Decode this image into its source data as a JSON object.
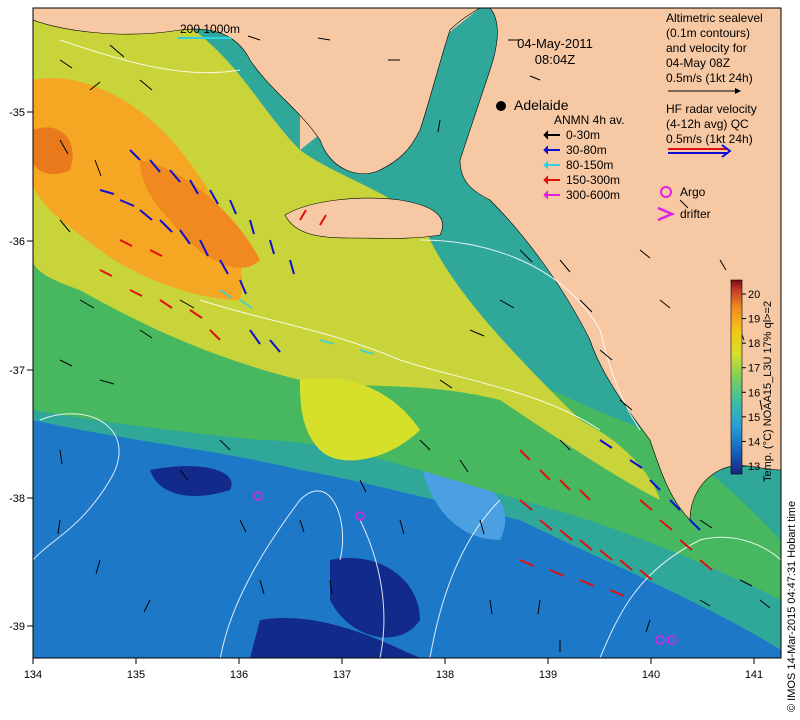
{
  "map": {
    "title_date": "04-May-2011",
    "title_time": "08:04Z",
    "scale_bar_label": "200  1000m",
    "city": "Adelaide",
    "lon_ticks": [
      "134",
      "135",
      "136",
      "137",
      "138",
      "139",
      "140",
      "141"
    ],
    "lat_ticks": [
      "-35",
      "-36",
      "-37",
      "-38",
      "-39"
    ]
  },
  "legend": {
    "altimetry_lines": [
      "Altimetric sealevel",
      "(0.1m contours)",
      "and velocity for",
      "04-May 08Z",
      "0.5m/s (1kt 24h)"
    ],
    "hf_radar_lines": [
      "HF radar velocity",
      "(4-12h avg) QC",
      "0.5m/s (1kt 24h)"
    ],
    "anmn_title": "ANMN 4h av.",
    "anmn_depths": [
      {
        "label": "0-30m",
        "color": "#000000"
      },
      {
        "label": "30-80m",
        "color": "#1010d0"
      },
      {
        "label": "80-150m",
        "color": "#30d0e0"
      },
      {
        "label": "150-300m",
        "color": "#e01010"
      },
      {
        "label": "300-600m",
        "color": "#e020e0"
      }
    ],
    "argo_label": "Argo",
    "drifter_label": "drifter"
  },
  "colorbar": {
    "label": "Temp. (°C) NOAA15_L3U 17% ql>=2",
    "ticks": [
      "13",
      "14",
      "15",
      "16",
      "17",
      "18",
      "19",
      "20"
    ],
    "colors": [
      "#1a237e",
      "#1565c0",
      "#26a0d8",
      "#3fbf9f",
      "#7ed05a",
      "#d6e02a",
      "#f5c518",
      "#f08a20",
      "#c0392b",
      "#7a0f0f"
    ]
  },
  "footer": {
    "credit": "© IMOS 14-Mar-2015 04:47:31 Hobart time"
  },
  "colors": {
    "land": "#f6c9a4",
    "frame": "#000000"
  }
}
